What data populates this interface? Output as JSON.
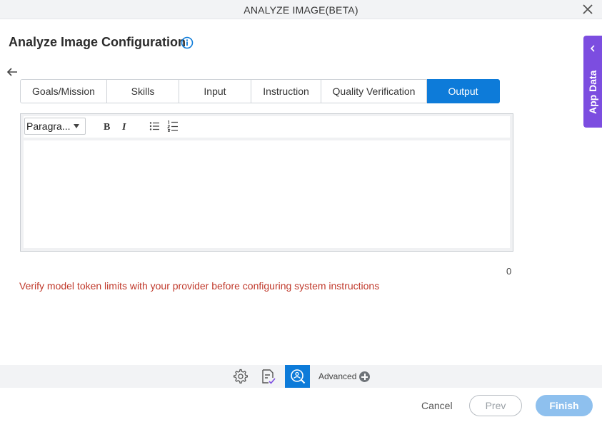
{
  "window": {
    "title": "ANALYZE IMAGE(BETA)"
  },
  "page": {
    "heading": "Analyze Image Configuration"
  },
  "tabs": [
    {
      "label": "Goals/Mission"
    },
    {
      "label": "Skills"
    },
    {
      "label": "Input"
    },
    {
      "label": "Instruction"
    },
    {
      "label": "Quality Verification"
    },
    {
      "label": "Output"
    }
  ],
  "active_tab": "Output",
  "editor": {
    "format_select": "Paragra...",
    "bold_label": "B",
    "italic_label": "I",
    "content": "",
    "char_count": "0"
  },
  "warning": "Verify model token limits with your provider before configuring system instructions",
  "side_panel": {
    "label": "App Data"
  },
  "bottom_toolbar": {
    "advanced_label": "Advanced"
  },
  "footer": {
    "cancel_label": "Cancel",
    "prev_label": "Prev",
    "finish_label": "Finish"
  },
  "colors": {
    "accent": "#0d7bd9",
    "side_panel": "#7c4de0",
    "warning": "#c0392b",
    "finish_disabled": "#8ec0ee"
  },
  "icons": [
    "close-icon",
    "info-icon",
    "back-arrow-icon",
    "bulleted-list-icon",
    "numbered-list-icon",
    "chevron-left-icon",
    "gear-icon",
    "document-check-icon",
    "image-search-icon",
    "plus-circle-icon"
  ]
}
